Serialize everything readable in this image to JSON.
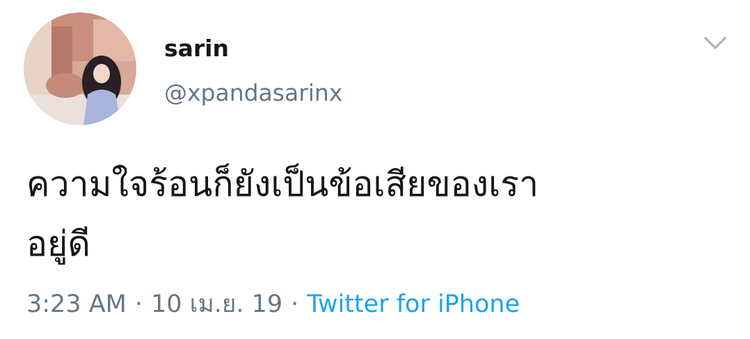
{
  "user": {
    "display_name": "sarin",
    "handle": "@xpandasarinx"
  },
  "tweet": {
    "text_lines": [
      "ความใจร้อนก็ยังเป็นข้อเสียของเรา",
      "อยู่ดี"
    ],
    "time": "3:23 AM",
    "date": "10 เม.ย. 19",
    "separator": "·",
    "source": "Twitter for iPhone"
  },
  "icons": {
    "menu": "chevron-down-icon",
    "avatar": "profile-photo"
  },
  "colors": {
    "text_primary": "#14171a",
    "text_secondary": "#657786",
    "link": "#1da1f2",
    "chevron": "#aab8c2"
  }
}
